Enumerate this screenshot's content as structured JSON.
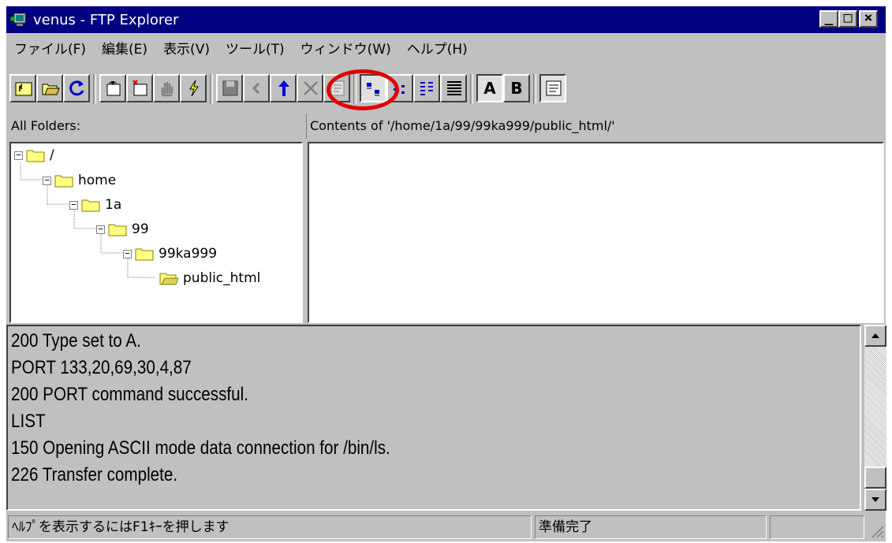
{
  "window": {
    "title": "venus - FTP Explorer",
    "minimize": "_",
    "maximize": "□",
    "close": "×"
  },
  "menu": [
    "ファイル(F)",
    "編集(E)",
    "表示(V)",
    "ツール(T)",
    "ウィンドウ(W)",
    "ヘルプ(H)"
  ],
  "toolbar": {
    "buttons": [
      "connect-icon",
      "open-icon",
      "refresh-icon",
      "new-folder-icon",
      "delete-folder-icon",
      "hand-icon",
      "lightning-icon",
      "save-icon",
      "download-icon",
      "upload-icon",
      "delete-icon",
      "properties-icon",
      "large-icons-icon",
      "small-icons-icon",
      "list-icon",
      "details-icon",
      "ascii-mode-icon",
      "binary-mode-icon",
      "log-icon"
    ],
    "ascii_label": "A",
    "binary_label": "B",
    "highlight_color": "#e00000"
  },
  "folders_pane": {
    "label": "All Folders:",
    "tree": [
      {
        "name": "/",
        "expander": "−"
      },
      {
        "name": "home",
        "expander": "−"
      },
      {
        "name": "1a",
        "expander": "−"
      },
      {
        "name": "99",
        "expander": "−"
      },
      {
        "name": "99ka999",
        "expander": "−"
      },
      {
        "name": "public_html",
        "expander": ""
      }
    ]
  },
  "contents_pane": {
    "label": "Contents of '/home/1a/99/99ka999/public_html/'"
  },
  "log": [
    "200 Type set to A.",
    "PORT 133,20,69,30,4,87",
    "200 PORT command successful.",
    "LIST",
    "150 Opening ASCII mode data connection for /bin/ls.",
    "226 Transfer complete."
  ],
  "status": {
    "help": "ﾍﾙﾌﾟを表示するにはF1ｷｰを押します",
    "state": "準備完了",
    "extra": ""
  }
}
